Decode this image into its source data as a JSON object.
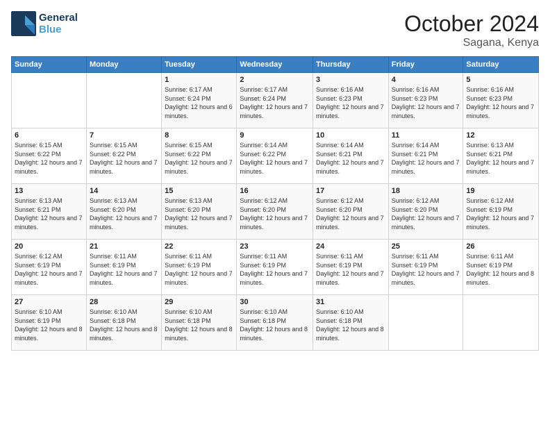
{
  "logo": {
    "line1": "General",
    "line2": "Blue"
  },
  "header": {
    "month": "October 2024",
    "location": "Sagana, Kenya"
  },
  "weekdays": [
    "Sunday",
    "Monday",
    "Tuesday",
    "Wednesday",
    "Thursday",
    "Friday",
    "Saturday"
  ],
  "weeks": [
    [
      {
        "day": "",
        "info": ""
      },
      {
        "day": "",
        "info": ""
      },
      {
        "day": "1",
        "info": "Sunrise: 6:17 AM\nSunset: 6:24 PM\nDaylight: 12 hours and 6 minutes."
      },
      {
        "day": "2",
        "info": "Sunrise: 6:17 AM\nSunset: 6:24 PM\nDaylight: 12 hours and 7 minutes."
      },
      {
        "day": "3",
        "info": "Sunrise: 6:16 AM\nSunset: 6:23 PM\nDaylight: 12 hours and 7 minutes."
      },
      {
        "day": "4",
        "info": "Sunrise: 6:16 AM\nSunset: 6:23 PM\nDaylight: 12 hours and 7 minutes."
      },
      {
        "day": "5",
        "info": "Sunrise: 6:16 AM\nSunset: 6:23 PM\nDaylight: 12 hours and 7 minutes."
      }
    ],
    [
      {
        "day": "6",
        "info": "Sunrise: 6:15 AM\nSunset: 6:22 PM\nDaylight: 12 hours and 7 minutes."
      },
      {
        "day": "7",
        "info": "Sunrise: 6:15 AM\nSunset: 6:22 PM\nDaylight: 12 hours and 7 minutes."
      },
      {
        "day": "8",
        "info": "Sunrise: 6:15 AM\nSunset: 6:22 PM\nDaylight: 12 hours and 7 minutes."
      },
      {
        "day": "9",
        "info": "Sunrise: 6:14 AM\nSunset: 6:22 PM\nDaylight: 12 hours and 7 minutes."
      },
      {
        "day": "10",
        "info": "Sunrise: 6:14 AM\nSunset: 6:21 PM\nDaylight: 12 hours and 7 minutes."
      },
      {
        "day": "11",
        "info": "Sunrise: 6:14 AM\nSunset: 6:21 PM\nDaylight: 12 hours and 7 minutes."
      },
      {
        "day": "12",
        "info": "Sunrise: 6:13 AM\nSunset: 6:21 PM\nDaylight: 12 hours and 7 minutes."
      }
    ],
    [
      {
        "day": "13",
        "info": "Sunrise: 6:13 AM\nSunset: 6:21 PM\nDaylight: 12 hours and 7 minutes."
      },
      {
        "day": "14",
        "info": "Sunrise: 6:13 AM\nSunset: 6:20 PM\nDaylight: 12 hours and 7 minutes."
      },
      {
        "day": "15",
        "info": "Sunrise: 6:13 AM\nSunset: 6:20 PM\nDaylight: 12 hours and 7 minutes."
      },
      {
        "day": "16",
        "info": "Sunrise: 6:12 AM\nSunset: 6:20 PM\nDaylight: 12 hours and 7 minutes."
      },
      {
        "day": "17",
        "info": "Sunrise: 6:12 AM\nSunset: 6:20 PM\nDaylight: 12 hours and 7 minutes."
      },
      {
        "day": "18",
        "info": "Sunrise: 6:12 AM\nSunset: 6:20 PM\nDaylight: 12 hours and 7 minutes."
      },
      {
        "day": "19",
        "info": "Sunrise: 6:12 AM\nSunset: 6:19 PM\nDaylight: 12 hours and 7 minutes."
      }
    ],
    [
      {
        "day": "20",
        "info": "Sunrise: 6:12 AM\nSunset: 6:19 PM\nDaylight: 12 hours and 7 minutes."
      },
      {
        "day": "21",
        "info": "Sunrise: 6:11 AM\nSunset: 6:19 PM\nDaylight: 12 hours and 7 minutes."
      },
      {
        "day": "22",
        "info": "Sunrise: 6:11 AM\nSunset: 6:19 PM\nDaylight: 12 hours and 7 minutes."
      },
      {
        "day": "23",
        "info": "Sunrise: 6:11 AM\nSunset: 6:19 PM\nDaylight: 12 hours and 7 minutes."
      },
      {
        "day": "24",
        "info": "Sunrise: 6:11 AM\nSunset: 6:19 PM\nDaylight: 12 hours and 7 minutes."
      },
      {
        "day": "25",
        "info": "Sunrise: 6:11 AM\nSunset: 6:19 PM\nDaylight: 12 hours and 7 minutes."
      },
      {
        "day": "26",
        "info": "Sunrise: 6:11 AM\nSunset: 6:19 PM\nDaylight: 12 hours and 8 minutes."
      }
    ],
    [
      {
        "day": "27",
        "info": "Sunrise: 6:10 AM\nSunset: 6:19 PM\nDaylight: 12 hours and 8 minutes."
      },
      {
        "day": "28",
        "info": "Sunrise: 6:10 AM\nSunset: 6:18 PM\nDaylight: 12 hours and 8 minutes."
      },
      {
        "day": "29",
        "info": "Sunrise: 6:10 AM\nSunset: 6:18 PM\nDaylight: 12 hours and 8 minutes."
      },
      {
        "day": "30",
        "info": "Sunrise: 6:10 AM\nSunset: 6:18 PM\nDaylight: 12 hours and 8 minutes."
      },
      {
        "day": "31",
        "info": "Sunrise: 6:10 AM\nSunset: 6:18 PM\nDaylight: 12 hours and 8 minutes."
      },
      {
        "day": "",
        "info": ""
      },
      {
        "day": "",
        "info": ""
      }
    ]
  ]
}
